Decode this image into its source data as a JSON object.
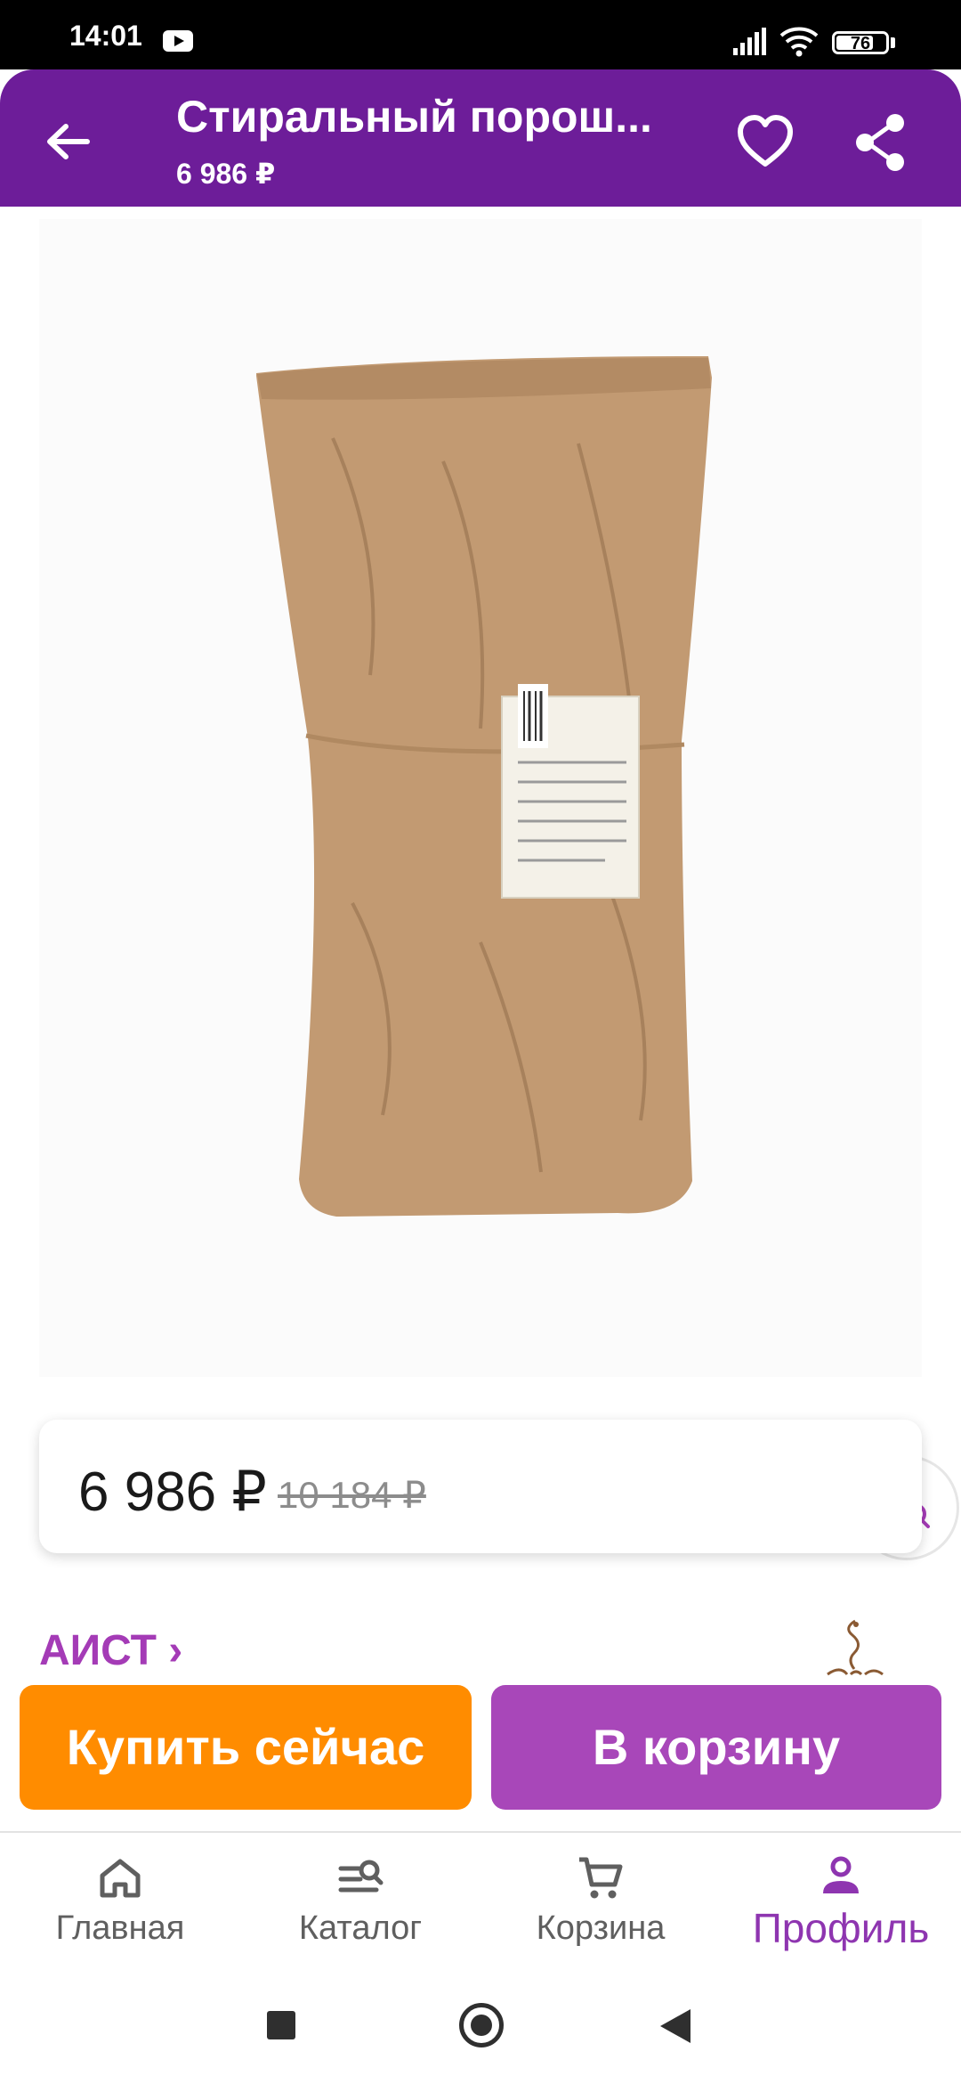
{
  "status_bar": {
    "time": "14:01",
    "battery_level": "76",
    "battery_fraction": 0.76,
    "icons": [
      "youtube-icon",
      "signal-icon",
      "wifi-icon",
      "battery-icon"
    ]
  },
  "header": {
    "title": "Стиральный порош...",
    "price": "6 986 ₽",
    "icons": [
      "back-arrow-icon",
      "heart-icon",
      "share-icon"
    ]
  },
  "product": {
    "image_icons": [
      "product-bag-image",
      "image-search-icon"
    ],
    "price_current": "6 986 ₽",
    "price_old": "10 184 ₽",
    "brand": "АИСТ ›"
  },
  "actions": {
    "buy_now": "Купить сейчас",
    "add_to_cart": "В корзину"
  },
  "bottom_nav": {
    "items": [
      {
        "label": "Главная",
        "icon": "home-icon",
        "active": false
      },
      {
        "label": "Каталог",
        "icon": "catalog-search-icon",
        "active": false
      },
      {
        "label": "Корзина",
        "icon": "cart-icon",
        "active": false
      },
      {
        "label": "Профиль",
        "icon": "profile-icon",
        "active": true
      }
    ]
  },
  "colors": {
    "header_background": "#6d1d99",
    "buy_now": "#ff8c00",
    "add_to_cart": "#a847b9",
    "active_nav": "#8e35b0",
    "brand_link": "#a43bb6"
  }
}
